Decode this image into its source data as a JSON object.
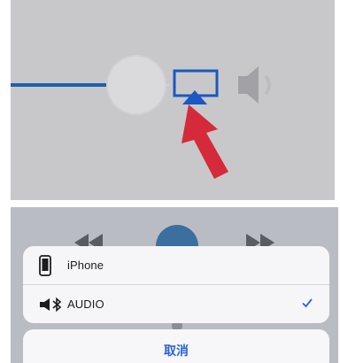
{
  "airplay_sheet": {
    "options": [
      {
        "label": "iPhone",
        "icon": "iphone-icon",
        "selected": false
      },
      {
        "label": "AUDIO",
        "icon": "bluetooth-speaker-icon",
        "selected": true
      }
    ],
    "cancel_label": "取消"
  },
  "icons": {
    "volume_slider_thumb": "slider-thumb",
    "airplay_button": "airplay-icon",
    "volume": "speaker-icon",
    "pointer_arrow": "red-arrow-pointer",
    "selected_mark": "checkmark-icon"
  },
  "colors": {
    "slider_track": "#1f5fb0",
    "airplay_outline": "#1b58c0",
    "pointer_arrow": "#d42a3a",
    "checkmark": "#2a64d4",
    "cancel_text": "#2a64d4"
  }
}
